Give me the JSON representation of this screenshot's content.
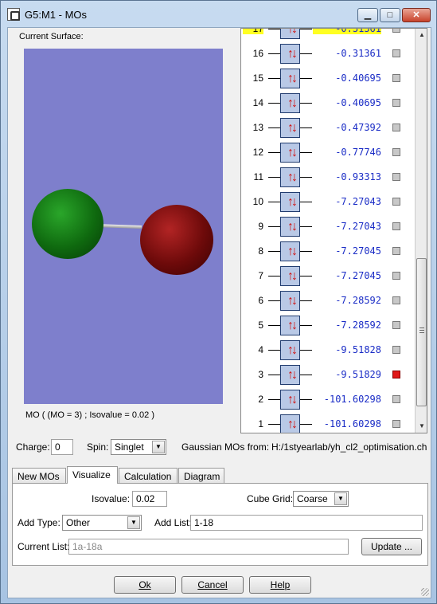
{
  "window": {
    "title": "G5:M1 - MOs",
    "min_symbol": "▁",
    "max_symbol": "□",
    "close_symbol": "✕"
  },
  "surface": {
    "label": "Current Surface:",
    "caption": "MO ( (MO = 3) ; Isovalue = 0.02 )"
  },
  "orbitals": [
    {
      "num": "17",
      "energy": "-0.31361",
      "selected": false,
      "highlight": true
    },
    {
      "num": "16",
      "energy": "-0.31361",
      "selected": false
    },
    {
      "num": "15",
      "energy": "-0.40695",
      "selected": false
    },
    {
      "num": "14",
      "energy": "-0.40695",
      "selected": false
    },
    {
      "num": "13",
      "energy": "-0.47392",
      "selected": false
    },
    {
      "num": "12",
      "energy": "-0.77746",
      "selected": false
    },
    {
      "num": "11",
      "energy": "-0.93313",
      "selected": false
    },
    {
      "num": "10",
      "energy": "-7.27043",
      "selected": false
    },
    {
      "num": "9",
      "energy": "-7.27043",
      "selected": false
    },
    {
      "num": "8",
      "energy": "-7.27045",
      "selected": false
    },
    {
      "num": "7",
      "energy": "-7.27045",
      "selected": false
    },
    {
      "num": "6",
      "energy": "-7.28592",
      "selected": false
    },
    {
      "num": "5",
      "energy": "-7.28592",
      "selected": false
    },
    {
      "num": "4",
      "energy": "-9.51828",
      "selected": false
    },
    {
      "num": "3",
      "energy": "-9.51829",
      "selected": true
    },
    {
      "num": "2",
      "energy": "-101.60298",
      "selected": false
    },
    {
      "num": "1",
      "energy": "-101.60298",
      "selected": false
    }
  ],
  "colors": {
    "highlight": "#ffff22",
    "selected": "#e01818",
    "energy_text": "#1a2cc6",
    "view_bg": "#7e7fcc"
  },
  "charge": {
    "label": "Charge:",
    "value": "0"
  },
  "spin": {
    "label": "Spin:",
    "value": "Singlet"
  },
  "source": {
    "label": "Gaussian MOs from:",
    "path": "H:/1styearlab/yh_cl2_optimisation.ch"
  },
  "tabs": [
    {
      "label": "New MOs"
    },
    {
      "label": "Visualize"
    },
    {
      "label": "Calculation"
    },
    {
      "label": "Diagram"
    }
  ],
  "visualize": {
    "isovalue_label": "Isovalue:",
    "isovalue": "0.02",
    "cube_grid_label": "Cube Grid:",
    "cube_grid": "Coarse",
    "add_type_label": "Add Type:",
    "add_type": "Other",
    "add_list_label": "Add List:",
    "add_list": "1-18",
    "current_list_label": "Current List:",
    "current_list": "1a-18a",
    "update_label": "Update ..."
  },
  "buttons": {
    "ok": "Ok",
    "cancel": "Cancel",
    "help": "Help"
  }
}
